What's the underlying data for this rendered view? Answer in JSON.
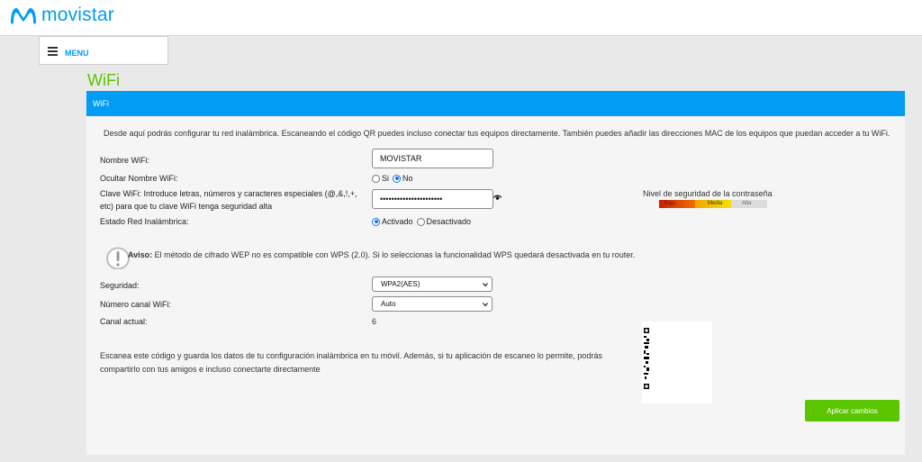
{
  "brand": {
    "name": "movistar",
    "color": "#019df4"
  },
  "menu": {
    "label": "MENU",
    "icon": "hamburger-icon"
  },
  "page": {
    "title": "WiFi"
  },
  "panel": {
    "header": "WiFi",
    "intro": "Desde aquí podrás configurar tu red inalámbrica. Escaneando el código QR puedes incluso conectar tus equipos directamente. También puedes añadir las direcciones MAC de los equipos que puedan acceder a tu WiFi."
  },
  "form": {
    "ssid_label": "Nombre WiFi:",
    "ssid_value": "MOVISTAR",
    "hide_label": "Ocultar Nombre WiFi:",
    "hide_options": [
      "Si",
      "No"
    ],
    "hide_selected": "No",
    "password_label_1": "Clave WiFi: Introduce letras, números y caracteres especiales (@,&,!,+,",
    "password_label_2": "etc) para que tu clave WiFi tenga seguridad alta",
    "password_value": "••••••••••••••••••••••",
    "strength_label": "Nivel de seguridad de la contraseña",
    "strength_levels": [
      "Baja",
      "Media",
      "Alta"
    ],
    "status_label": "Estado Red Inalámbrica:",
    "status_options": [
      "Activado",
      "Desactivado"
    ],
    "status_selected": "Activado",
    "warning_title": "Aviso:",
    "warning_text": " El método de cifrado WEP no es compatible con WPS (2.0). Si lo seleccionas la funcionalidad WPS quedará desactivada en tu router.",
    "security_label": "Seguridad:",
    "security_value": "WPA2(AES)",
    "channel_label": "Número canal WiFi:",
    "channel_value": "Auto",
    "current_channel_label": "Canal actual:",
    "current_channel_value": "6",
    "qr_text": "Escanea este código y guarda los datos de tu configuración inalámbrica en tu móvil. Además, si tu aplicación de escaneo lo permite, podrás compartirlo con tus amigos e incluso conectarte directamente",
    "apply_label": "Aplicar cambios"
  },
  "colors": {
    "accent": "#019df4",
    "green": "#5bc500",
    "panel": "#f5f5f5"
  }
}
